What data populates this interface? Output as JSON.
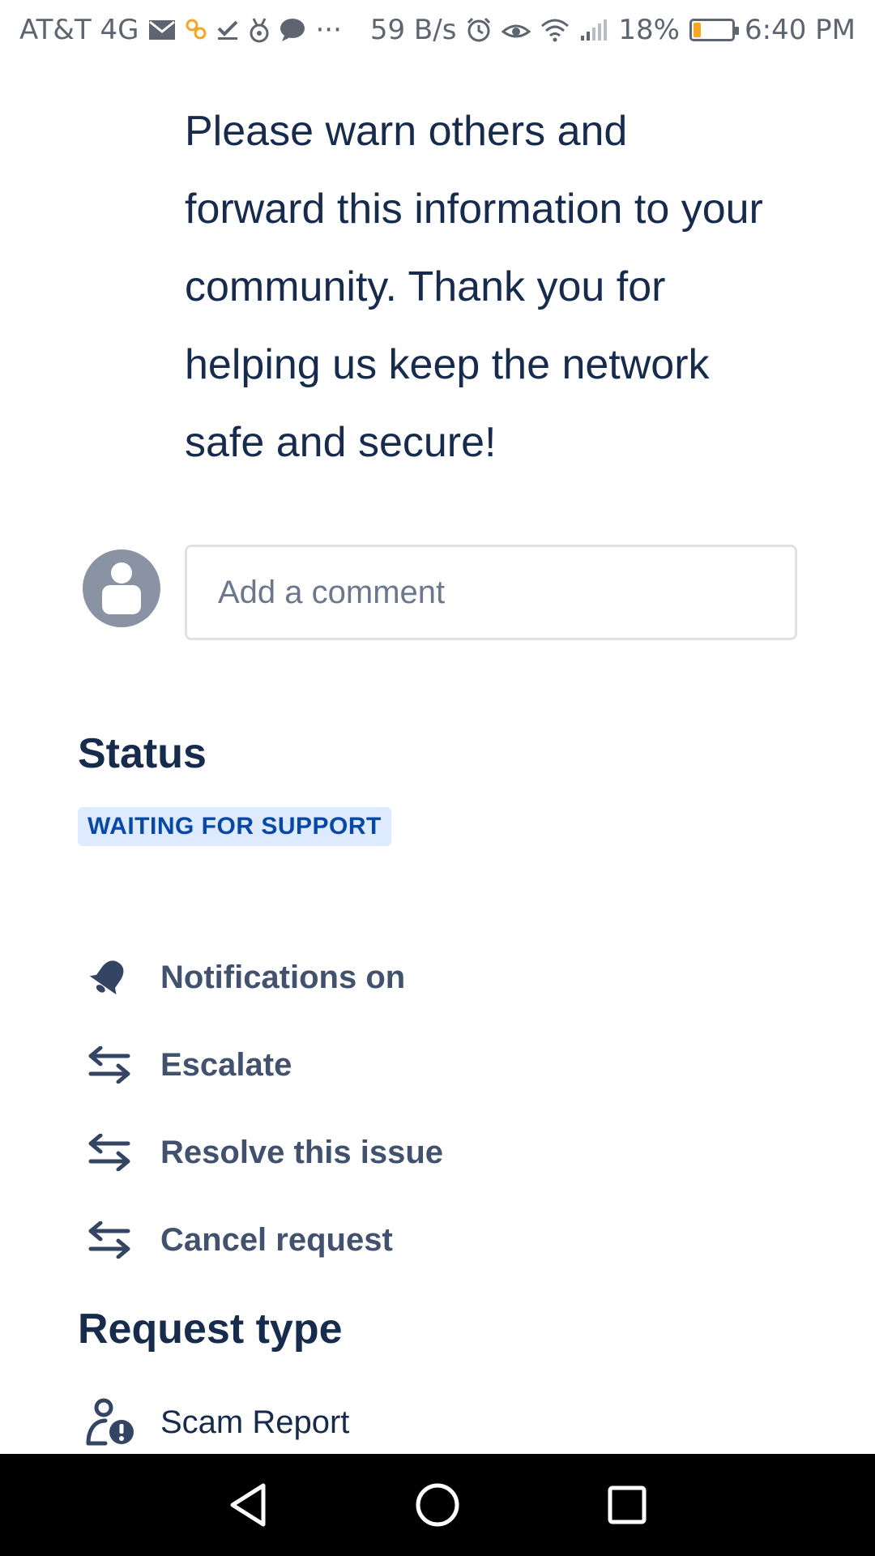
{
  "status_bar": {
    "carrier": "AT&T 4G",
    "net_speed": "59 B/s",
    "battery_percent": "18%",
    "battery_level": 0.18,
    "time": "6:40 PM",
    "ellipsis": "···",
    "icons": [
      "mail-icon",
      "app-icon",
      "check-icon",
      "medal-icon",
      "chat-icon",
      "alarm-icon",
      "eye-icon",
      "wifi-icon",
      "signal-icon",
      "battery-icon"
    ]
  },
  "message": {
    "text": "Please warn others and forward this information to your community. Thank you for helping us keep the network safe and secure!"
  },
  "comment": {
    "placeholder": "Add a comment"
  },
  "status": {
    "title": "Status",
    "value": "WAITING FOR SUPPORT",
    "lozenge_bg": "#deebff",
    "lozenge_text": "#0747a6"
  },
  "actions": [
    {
      "label": "Notifications on",
      "icon": "bell-icon"
    },
    {
      "label": "Escalate",
      "icon": "transition-icon"
    },
    {
      "label": "Resolve this issue",
      "icon": "transition-icon"
    },
    {
      "label": "Cancel request",
      "icon": "transition-icon"
    }
  ],
  "request_type": {
    "title": "Request type",
    "value": "Scam Report",
    "icon": "person-alert-icon"
  },
  "nav": {
    "buttons": [
      "back-icon",
      "home-icon",
      "recents-icon"
    ]
  },
  "colors": {
    "text_primary": "#172b4d",
    "text_secondary": "#42526e",
    "avatar": "#8993a4",
    "battery_low": "#f6a623"
  }
}
